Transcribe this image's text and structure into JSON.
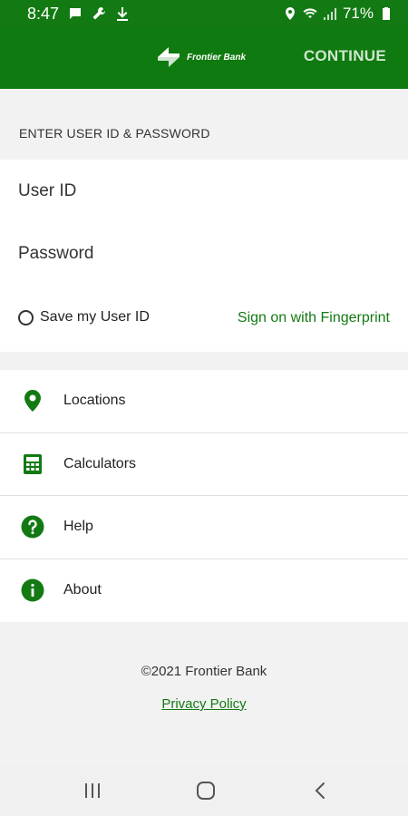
{
  "status_bar": {
    "time": "8:47",
    "battery": "71%"
  },
  "app_bar": {
    "logo_text": "Frontier Bank",
    "continue_label": "CONTINUE"
  },
  "login": {
    "section_title": "ENTER USER ID & PASSWORD",
    "user_id_placeholder": "User ID",
    "password_placeholder": "Password",
    "save_label": "Save my User ID",
    "fingerprint_label": "Sign on with Fingerprint"
  },
  "menu": {
    "items": [
      {
        "label": "Locations",
        "icon": "location-pin-icon"
      },
      {
        "label": "Calculators",
        "icon": "calculator-icon"
      },
      {
        "label": "Help",
        "icon": "help-icon"
      },
      {
        "label": "About",
        "icon": "info-icon"
      }
    ]
  },
  "footer": {
    "copyright": "©2021 Frontier Bank",
    "privacy_label": "Privacy Policy"
  },
  "colors": {
    "brand_green": "#0f7a0f",
    "link_green": "#137a13"
  }
}
